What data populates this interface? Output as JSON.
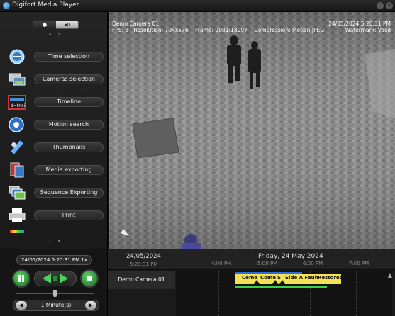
{
  "window": {
    "title": "Digifort Media Player"
  },
  "sidebar": {
    "toggle": {
      "left_icon": "person-icon",
      "right_icon": "speaker-icon",
      "right_label": "◂))"
    },
    "up_arrows": "▴ ▾",
    "down_arrows": "▴ ▾",
    "items": [
      {
        "label": "Time selection",
        "icon": "clock-icon"
      },
      {
        "label": "Cameras selection",
        "icon": "cameras-icon"
      },
      {
        "label": "Timeline",
        "icon": "timeline-icon",
        "badge": "# # # #"
      },
      {
        "label": "Motion search",
        "icon": "motion-search-icon"
      },
      {
        "label": "Thumbnails",
        "icon": "thumbnails-icon"
      },
      {
        "label": "Media exporting",
        "icon": "media-export-icon"
      },
      {
        "label": "Sequence Exporting",
        "icon": "sequence-export-icon"
      },
      {
        "label": "Print",
        "icon": "printer-icon"
      }
    ]
  },
  "video": {
    "camera": "Demo Camera 01",
    "fps": "FPS: 3",
    "resolution": "Resolution: 704x576",
    "frame": "Frame: 9081/18097",
    "compression": "Compression: Motion JPEG",
    "timestamp": "24/05/2024 5:20:31 PM",
    "watermark": "Watermark: Valid"
  },
  "playback": {
    "datetime": "24/05/2024 5:20:31 PM 1x",
    "interval": "1 Minute(s)",
    "prev_label": "◀",
    "next_label": "▶"
  },
  "timeline": {
    "date": "24/05/2024",
    "time": "5:20:31 PM",
    "day": "Friday, 24 May 2024",
    "ticks": [
      "4:00 PM",
      "5:00 PM",
      "6:00 PM",
      "7:00 PM"
    ],
    "camera": "Demo Camera 01",
    "events": [
      "Come",
      "Come",
      "S",
      "Side A Fault",
      "Restored"
    ]
  },
  "colors": {
    "recording": "#3ccf4a",
    "motion": "#2b6de0",
    "events": "#f3e255",
    "cursor": "#e02525"
  }
}
